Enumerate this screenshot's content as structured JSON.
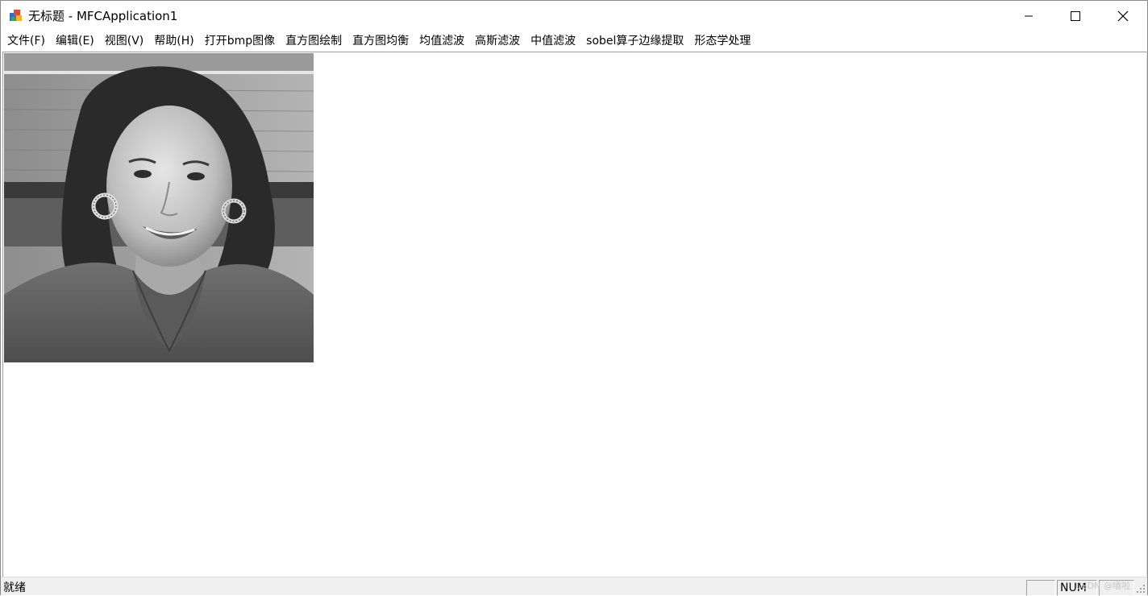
{
  "window": {
    "title": "无标题 - MFCApplication1",
    "icon": "mfc-app-icon"
  },
  "caption_buttons": {
    "minimize": "minimize-icon",
    "maximize": "maximize-icon",
    "close": "close-icon"
  },
  "menu": {
    "items": [
      {
        "label": "文件(F)"
      },
      {
        "label": "编辑(E)"
      },
      {
        "label": "视图(V)"
      },
      {
        "label": "帮助(H)"
      },
      {
        "label": "打开bmp图像"
      },
      {
        "label": "直方图绘制"
      },
      {
        "label": "直方图均衡"
      },
      {
        "label": "均值滤波"
      },
      {
        "label": "高斯滤波"
      },
      {
        "label": "中值滤波"
      },
      {
        "label": "sobel算子边缘提取"
      },
      {
        "label": "形态学处理"
      }
    ]
  },
  "canvas": {
    "image": "grayscale portrait of smiling woman with curly hair and hoop earrings"
  },
  "statusbar": {
    "text": "就绪",
    "caps_pane": "",
    "num_pane": "NUM",
    "scrl_pane": "",
    "watermark": "CSDN @嘻啦"
  },
  "colors": {
    "window_bg": "#ffffff",
    "statusbar_bg": "#f0f0f0",
    "border": "#a0a0a0"
  }
}
